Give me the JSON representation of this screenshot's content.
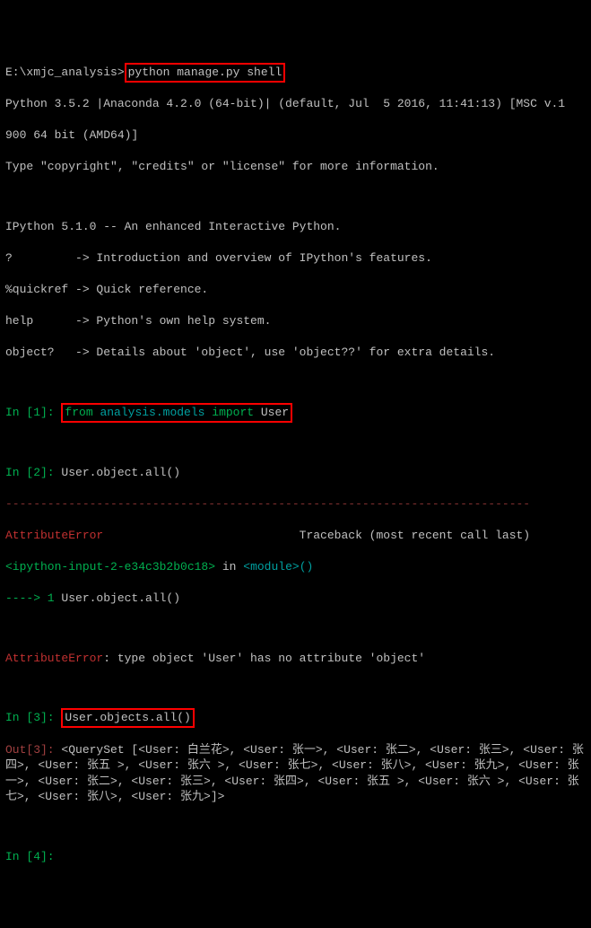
{
  "prompt": {
    "path": "E:\\xmjc_analysis>",
    "cmd": "python manage.py shell"
  },
  "startup": {
    "l1": "Python 3.5.2 |Anaconda 4.2.0 (64-bit)| (default, Jul  5 2016, 11:41:13) [MSC v.1",
    "l2": "900 64 bit (AMD64)]",
    "l3": "Type \"copyright\", \"credits\" or \"license\" for more information.",
    "l4": "IPython 5.1.0 -- An enhanced Interactive Python.",
    "l5": "?         -> Introduction and overview of IPython's features.",
    "l6": "%quickref -> Quick reference.",
    "l7": "help      -> Python's own help system.",
    "l8": "object?   -> Details about 'object', use 'object??' for extra details."
  },
  "in1": {
    "prompt": "In [1]: ",
    "kw_from": "from",
    "mod": " analysis.models ",
    "kw_import": "import",
    "cls": " User"
  },
  "in2": {
    "prompt": "In [2]: ",
    "code": "User.object.all()"
  },
  "tb": {
    "dashes": "---------------------------------------------------------------------------",
    "err": "AttributeError",
    "trace_label": "                            Traceback (most recent call last)",
    "loc_a": "<ipython-input-2-e34c3b2b0c18>",
    "loc_b": " in ",
    "loc_c": "<module>",
    "loc_d": "()",
    "arrow": "----> 1",
    "arrow_code": " User.object.all()",
    "err2": "AttributeError",
    "msg": ": type object 'User' has no attribute 'object'"
  },
  "in3": {
    "prompt": "In [3]: ",
    "code": "User.objects.all()"
  },
  "out3": {
    "prompt": "Out[3]: ",
    "val": "<QuerySet [<User: 白兰花>, <User: 张一>, <User: 张二>, <User: 张三>, <User: 张四>, <User: 张五 >, <User: 张六 >, <User: 张七>, <User: 张八>, <User: 张九>, <User: 张一>, <User: 张二>, <User: 张三>, <User: 张四>, <User: 张五 >, <User: 张六 >, <User: 张七>, <User: 张八>, <User: 张九>]>"
  },
  "in4": {
    "prompt": "In [4]: "
  },
  "highlight_boxes": [
    {
      "target": "shell-command",
      "purpose": "highlight python manage.py shell"
    },
    {
      "target": "import-statement",
      "purpose": "highlight from analysis.models import User"
    },
    {
      "target": "objects-all-call",
      "purpose": "highlight User.objects.all()"
    }
  ]
}
